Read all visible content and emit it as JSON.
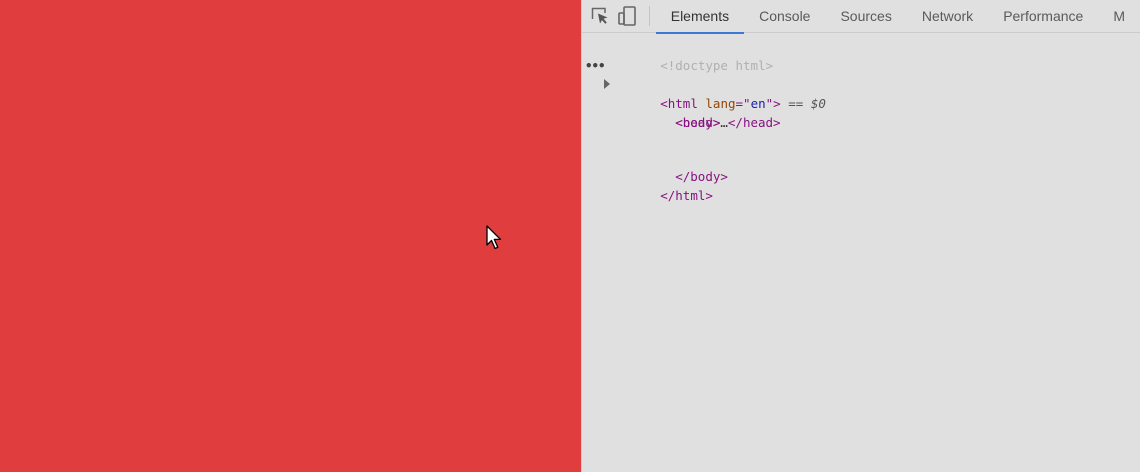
{
  "viewport": {
    "background": "#e03e3e"
  },
  "devtools": {
    "toolbar": {
      "inspect_icon": "inspect-element-icon",
      "device_icon": "device-toolbar-icon",
      "tabs": [
        {
          "label": "Elements",
          "active": true
        },
        {
          "label": "Console",
          "active": false
        },
        {
          "label": "Sources",
          "active": false
        },
        {
          "label": "Network",
          "active": false
        },
        {
          "label": "Performance",
          "active": false
        },
        {
          "label": "M",
          "active": false
        }
      ]
    },
    "dom_tree": {
      "doctype": "<!doctype html>",
      "html_open_tag": "<html",
      "html_attr_name": "lang",
      "html_attr_eq": "=\"",
      "html_attr_value": "en",
      "html_attr_close": "\">",
      "selected_marker": "==",
      "selected_var": "$0",
      "ellipsis": "•••",
      "head_open": "<head>",
      "head_ellipsis": "…",
      "head_close": "</head>",
      "body_open": "<body>",
      "body_close": "</body>",
      "html_close": "</html>"
    },
    "accent_color": "#3c78d8"
  }
}
